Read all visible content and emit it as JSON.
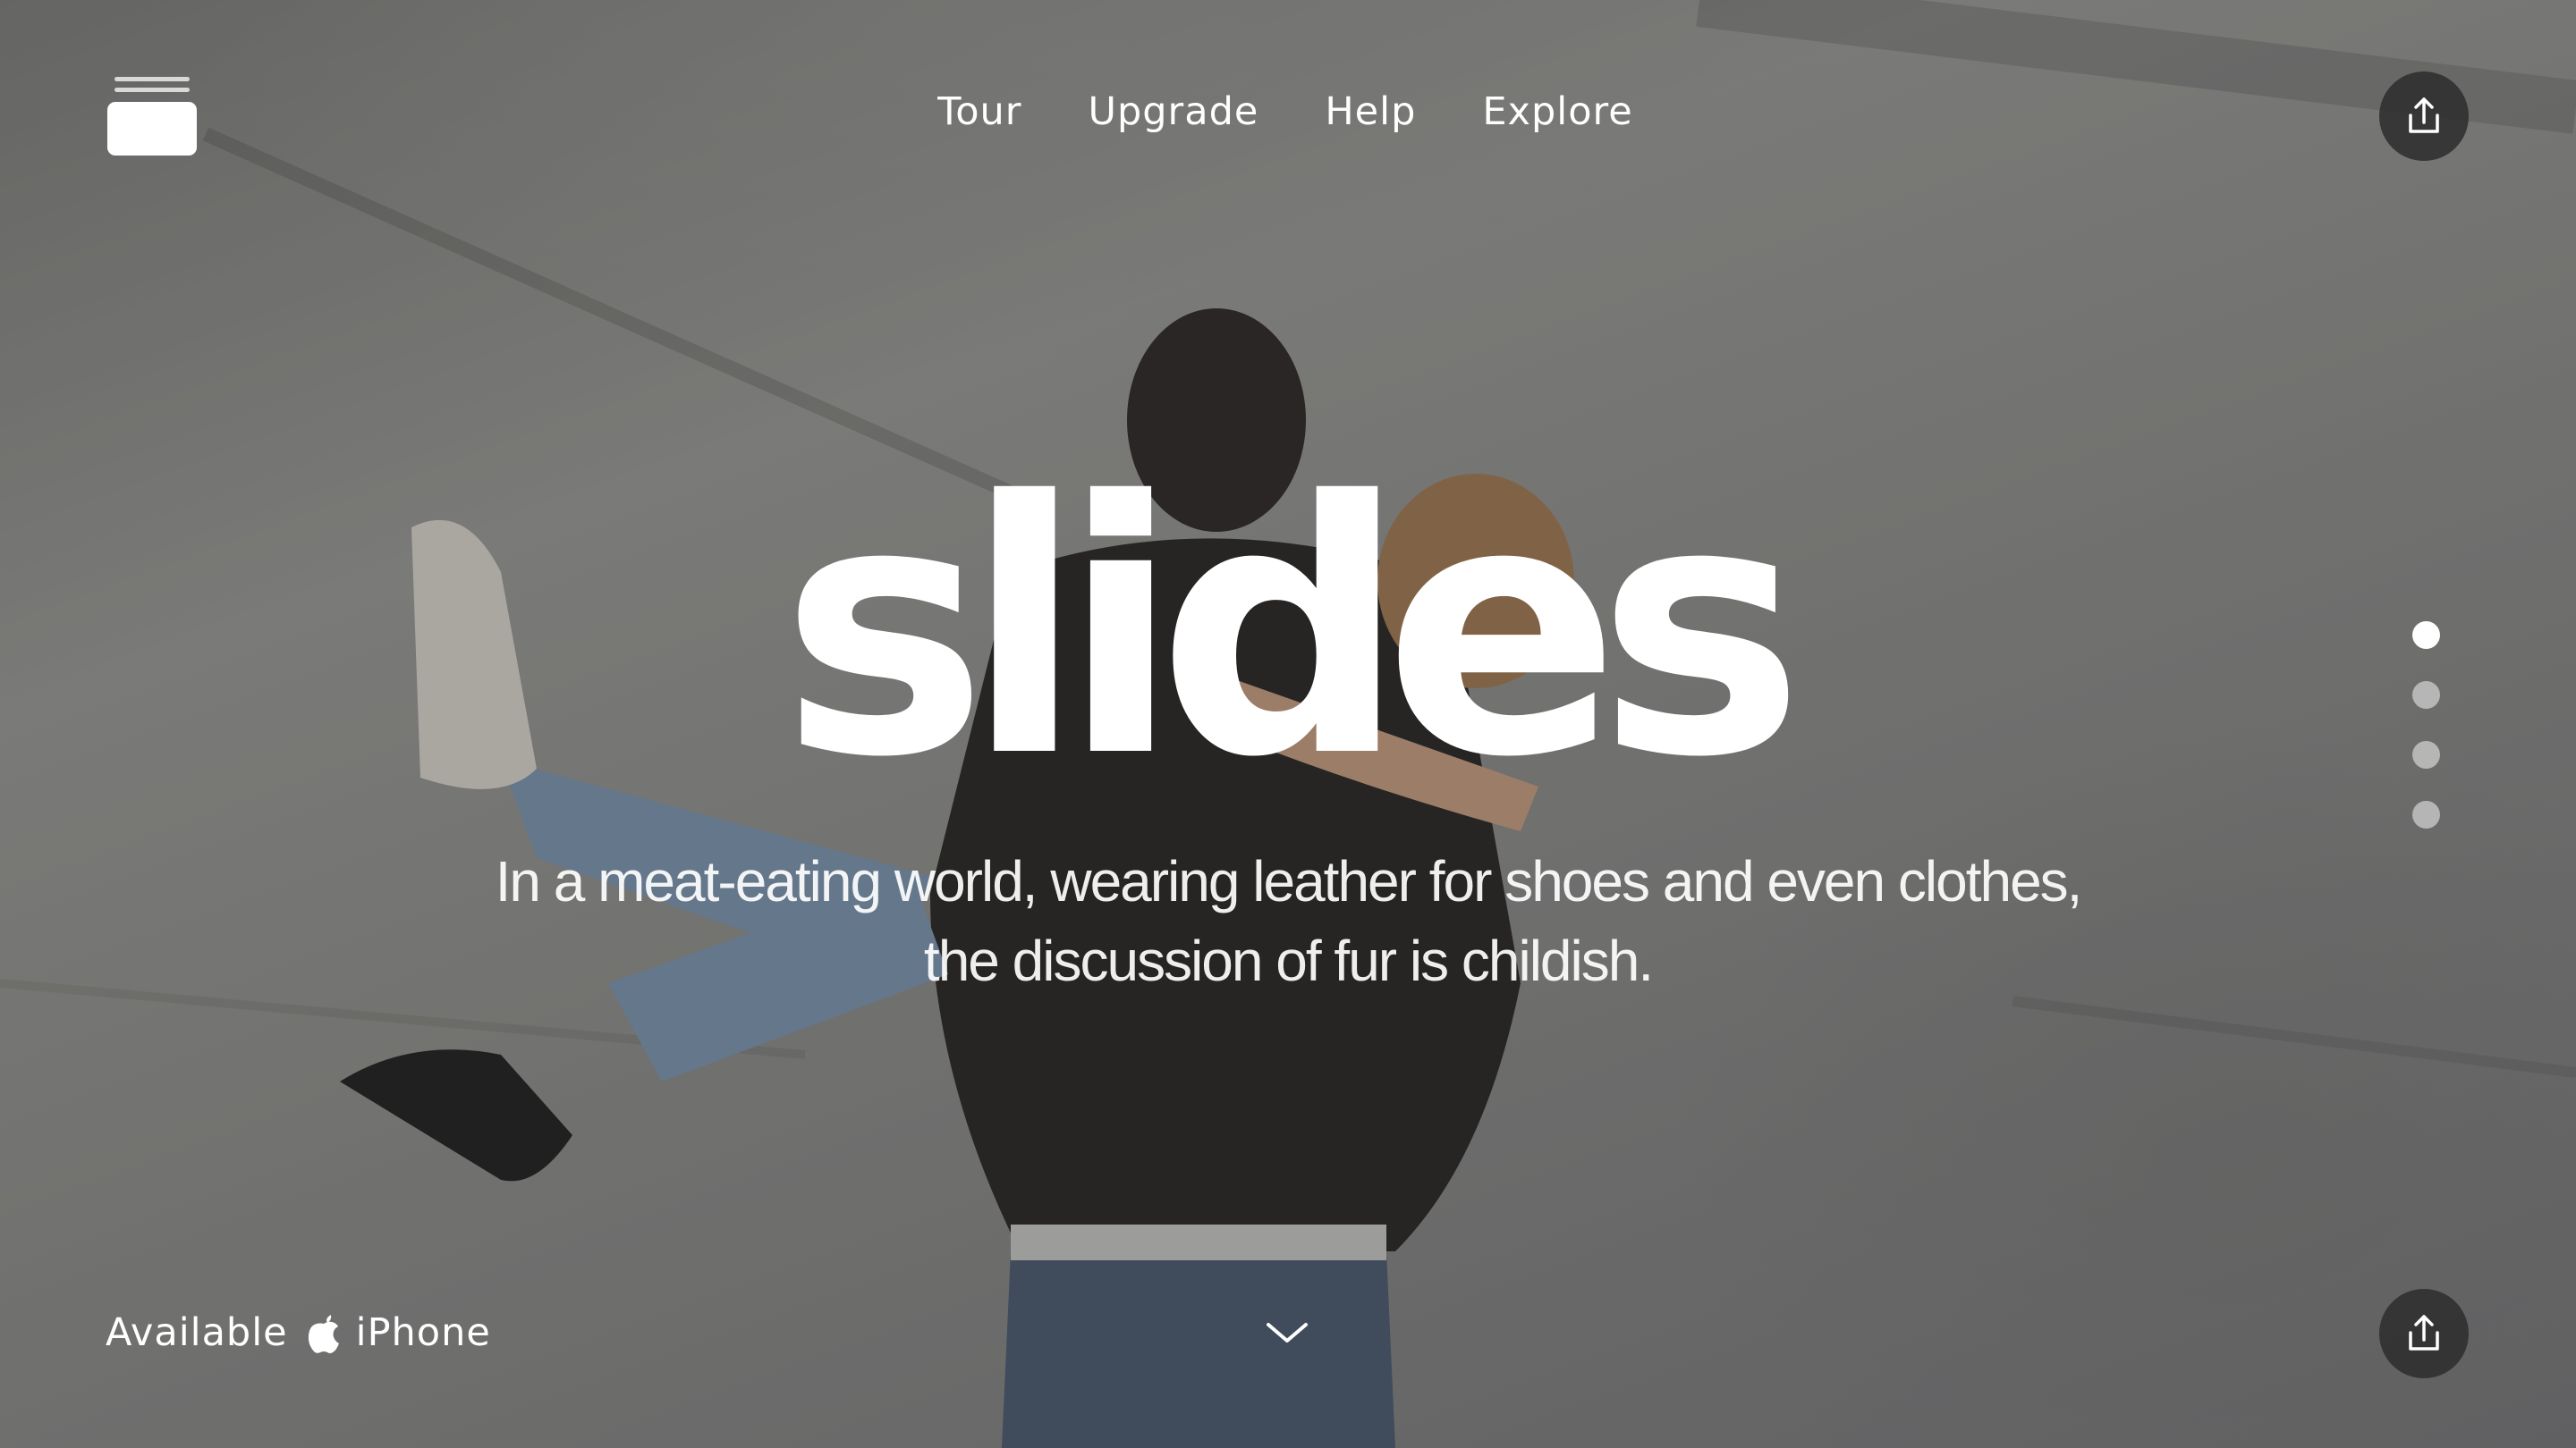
{
  "app": {
    "logo_icon": "stacked-cards-icon"
  },
  "nav": {
    "items": [
      {
        "label": "Tour"
      },
      {
        "label": "Upgrade"
      },
      {
        "label": "Help"
      },
      {
        "label": "Explore"
      }
    ]
  },
  "hero": {
    "title": "slides",
    "subtitle_line1": "In a meat-eating world, wearing leather for shoes and even clothes,",
    "subtitle_line2": "the discussion of fur is childish."
  },
  "pager": {
    "count": 4,
    "active_index": 0
  },
  "footer": {
    "availability_label": "Available",
    "platform_icon": "apple-icon",
    "platform_label": "iPhone",
    "scroll_icon": "chevron-down-icon"
  },
  "actions": {
    "share_icon": "share-icon"
  },
  "colors": {
    "text": "#ffffff",
    "button_bg": "#2d2d2d",
    "dot_inactive": "rgba(255,255,255,0.5)"
  }
}
